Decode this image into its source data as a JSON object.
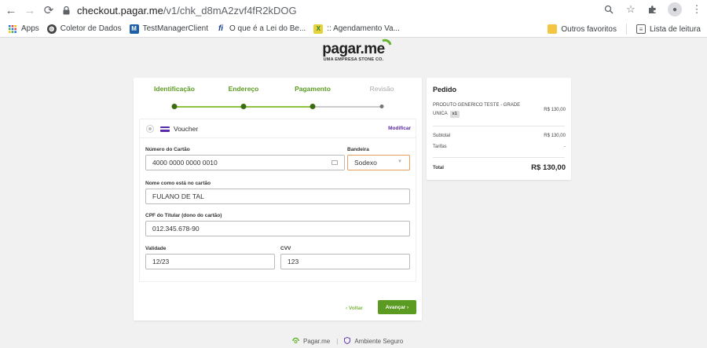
{
  "browser": {
    "url_host": "checkout.pagar.me",
    "url_path": "/v1/chk_d8mA2zvf4fR2kDOG"
  },
  "bookmarks": {
    "items": [
      {
        "label": "Apps",
        "icon": "apps-grid-icon"
      },
      {
        "label": "Coletor de Dados",
        "icon": "globe-icon"
      },
      {
        "label": "TestManagerClient",
        "icon": "m-icon"
      },
      {
        "label": "O que é a Lei do Be...",
        "icon": "fi-icon"
      },
      {
        "label": ":: Agendamento Va...",
        "icon": "agendamento-icon"
      }
    ],
    "right": [
      {
        "label": "Outros favoritos",
        "icon": "folder-icon"
      },
      {
        "label": "Lista de leitura",
        "icon": "reading-list-icon"
      }
    ]
  },
  "logo": {
    "main": "pagar.me",
    "sub": "UMA EMPRESA STONE CO."
  },
  "steps": [
    {
      "label": "Identificação",
      "state": "done"
    },
    {
      "label": "Endereço",
      "state": "done"
    },
    {
      "label": "Pagamento",
      "state": "current"
    },
    {
      "label": "Revisão",
      "state": "pending"
    }
  ],
  "payment": {
    "method": "Voucher",
    "modify": "Modificar"
  },
  "form": {
    "card_number_label": "Número do Cartão",
    "card_number": "4000 0000 0000 0010",
    "brand_label": "Bandeira",
    "brand": "Sodexo",
    "name_label": "Nome como está no cartão",
    "name": "FULANO DE TAL",
    "cpf_label": "CPF do Titular (dono do cartão)",
    "cpf": "012.345.678-90",
    "validity_label": "Validade",
    "validity": "12/23",
    "cvv_label": "CVV",
    "cvv": "123"
  },
  "actions": {
    "back": "‹ Voltar",
    "next": "Avançar ›"
  },
  "summary": {
    "title": "Pedido",
    "product_line1": "PRODUTO GENERICO TESTE - GRADE",
    "product_line2": "UNICA",
    "qty": "x1",
    "product_price": "R$ 130,00",
    "subtotal_label": "Subtotal",
    "subtotal": "R$ 130,00",
    "fees_label": "Tarifas",
    "fees": "-",
    "total_label": "Total",
    "total": "R$ 130,00"
  },
  "footer": {
    "brand": "Pagar.me",
    "divider": "|",
    "secure": "Ambiente Seguro"
  },
  "colors": {
    "accent_green": "#5b9b22",
    "accent_purple": "#5b2aa6",
    "select_border": "#e8a060"
  }
}
